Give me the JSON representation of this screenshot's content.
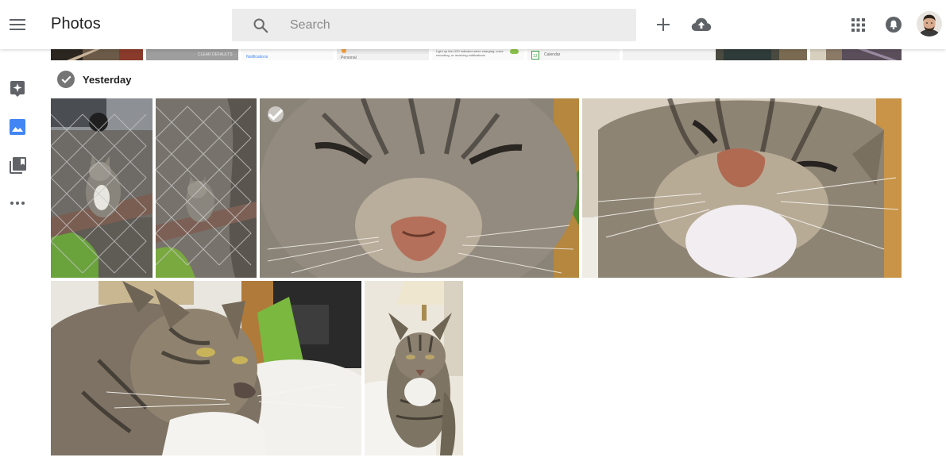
{
  "app": {
    "title": "Photos",
    "accent_color": "#4285f4"
  },
  "search": {
    "placeholder": "Search",
    "value": ""
  },
  "toolbar": {
    "icons": [
      "menu-icon",
      "search-icon",
      "add-icon",
      "upload-icon",
      "apps-grid-icon",
      "notifications-icon",
      "avatar"
    ]
  },
  "sidebar": {
    "items": [
      {
        "name": "assistant",
        "icon": "assistant-sparkle-icon",
        "active": false
      },
      {
        "name": "photos",
        "icon": "photo-icon",
        "active": true
      },
      {
        "name": "albums",
        "icon": "albums-icon",
        "active": false
      },
      {
        "name": "more",
        "icon": "more-horizontal-icon",
        "active": false
      }
    ]
  },
  "previous_section": {
    "strip_texts": [
      "CLEAR DEFAULTS",
      "Notifications",
      "Personal",
      "Light up the LED indicator when charging, voice recording, or receiving notifications",
      "13",
      "Calendar"
    ]
  },
  "sections": [
    {
      "date_label": "Yesterday",
      "photos": [
        {
          "description": "cat behind chain-link fence"
        },
        {
          "description": "cat behind chain-link fence, close"
        },
        {
          "description": "cat nose close-up"
        },
        {
          "description": "cat face close-up"
        },
        {
          "description": "tabby cat on bed"
        },
        {
          "description": "tabby cat under lamp"
        }
      ]
    }
  ]
}
